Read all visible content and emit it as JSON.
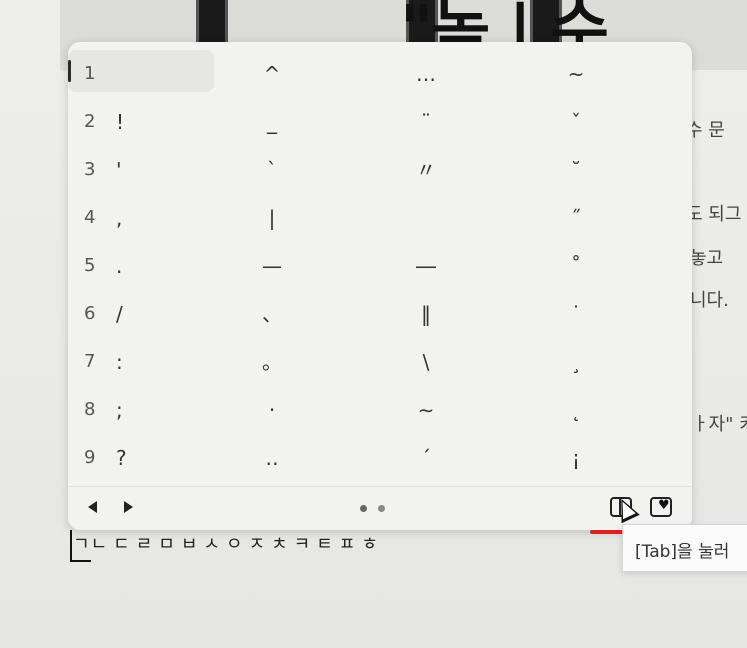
{
  "background": {
    "banner_text": "\"녹 | 수",
    "lines": [
      "수 문",
      "도 되그",
      "놓고",
      "니다.",
      "ㅏ자\" 키"
    ]
  },
  "palette": {
    "rows": [
      {
        "num": "1",
        "sym": "",
        "c1": "^",
        "c2": "…",
        "c3": "~"
      },
      {
        "num": "2",
        "sym": "!",
        "c1": "_",
        "c2": "¨",
        "c3": "ˇ"
      },
      {
        "num": "3",
        "sym": "'",
        "c1": "`",
        "c2": "〃",
        "c3": "˘"
      },
      {
        "num": "4",
        "sym": ",",
        "c1": "|",
        "c2": "",
        "c3": "˝"
      },
      {
        "num": "5",
        "sym": ".",
        "c1": "—",
        "c2": "―",
        "c3": "˚"
      },
      {
        "num": "6",
        "sym": "/",
        "c1": "、",
        "c2": "‖",
        "c3": "˙"
      },
      {
        "num": "7",
        "sym": ":",
        "c1": "。",
        "c2": "\\",
        "c3": "¸"
      },
      {
        "num": "8",
        "sym": ";",
        "c1": "·",
        "c2": "∼",
        "c3": "˛"
      },
      {
        "num": "9",
        "sym": "?",
        "c1": "‥",
        "c2": "´",
        "c3": "¡"
      }
    ],
    "selected_row": 0
  },
  "jamo": [
    "ㄱ",
    "ㄴ",
    "ㄷ",
    "ㄹ",
    "ㅁ",
    "ㅂ",
    "ㅅ",
    "ㅇ",
    "ㅈ",
    "ㅊ",
    "ㅋ",
    "ㅌ",
    "ㅍ",
    "ㅎ"
  ],
  "tooltip": {
    "text": "[Tab]을 눌러"
  },
  "icons": {
    "prev": "chevron-left-icon",
    "next": "chevron-right-icon",
    "expand": "expand-panel-icon",
    "favorite": "heart-icon"
  },
  "colors": {
    "highlight": "#e02020"
  }
}
